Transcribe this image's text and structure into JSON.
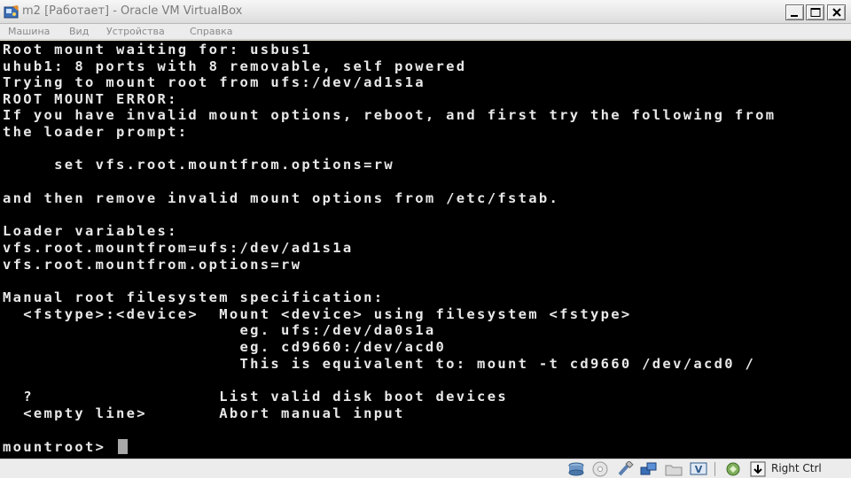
{
  "window": {
    "title": "m2 [Работает] - Oracle VM VirtualBox"
  },
  "menu": {
    "items": [
      "Машина",
      "Вид",
      "Устройства",
      "Справка"
    ]
  },
  "console": {
    "lines": [
      "Root mount waiting for: usbus1",
      "uhub1: 8 ports with 8 removable, self powered",
      "Trying to mount root from ufs:/dev/ad1s1a",
      "ROOT MOUNT ERROR:",
      "If you have invalid mount options, reboot, and first try the following from",
      "the loader prompt:",
      "",
      "     set vfs.root.mountfrom.options=rw",
      "",
      "and then remove invalid mount options from /etc/fstab.",
      "",
      "Loader variables:",
      "vfs.root.mountfrom=ufs:/dev/ad1s1a",
      "vfs.root.mountfrom.options=rw",
      "",
      "Manual root filesystem specification:",
      "  <fstype>:<device>  Mount <device> using filesystem <fstype>",
      "                       eg. ufs:/dev/da0s1a",
      "                       eg. cd9660:/dev/acd0",
      "                       This is equivalent to: mount -t cd9660 /dev/acd0 /",
      "",
      "  ?                  List valid disk boot devices",
      "  <empty line>       Abort manual input",
      ""
    ],
    "prompt": "mountroot> "
  },
  "statusbar": {
    "icons": [
      "hard-disk-icon",
      "cd-drive-icon",
      "usb-icon",
      "network-icon",
      "shared-folders-icon",
      "display-capture-icon",
      "virtualization-icon",
      "mouse-integration-icon"
    ],
    "host_key": "Right Ctrl"
  }
}
